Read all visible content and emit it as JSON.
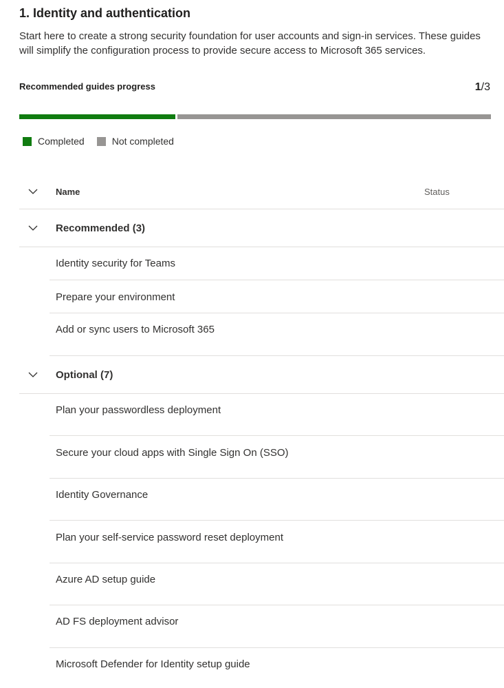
{
  "section": {
    "title": "1. Identity and authentication",
    "description": "Start here to create a strong security foundation for user accounts and sign-in services. These guides will simplify the configuration process to provide secure access to Microsoft 365 services."
  },
  "progress": {
    "label": "Recommended guides progress",
    "completed": "1",
    "total": "/3",
    "fraction_completed": 0.333,
    "colors": {
      "completed": "#107c10",
      "not_completed": "#979593"
    }
  },
  "legend": {
    "completed": "Completed",
    "not_completed": "Not completed"
  },
  "table": {
    "columns": {
      "name": "Name",
      "status": "Status"
    },
    "groups": [
      {
        "label": "Recommended (3)",
        "items": [
          "Identity security for Teams",
          "Prepare your environment",
          "Add or sync users to Microsoft 365"
        ]
      },
      {
        "label": "Optional (7)",
        "items": [
          "Plan your passwordless deployment",
          "Secure your cloud apps with Single Sign On (SSO)",
          "Identity Governance",
          "Plan your self-service password reset deployment",
          "Azure AD setup guide",
          "AD FS deployment advisor",
          "Microsoft Defender for Identity setup guide"
        ]
      }
    ]
  },
  "icons": {
    "group_toggle": "chevron-down-icon"
  }
}
